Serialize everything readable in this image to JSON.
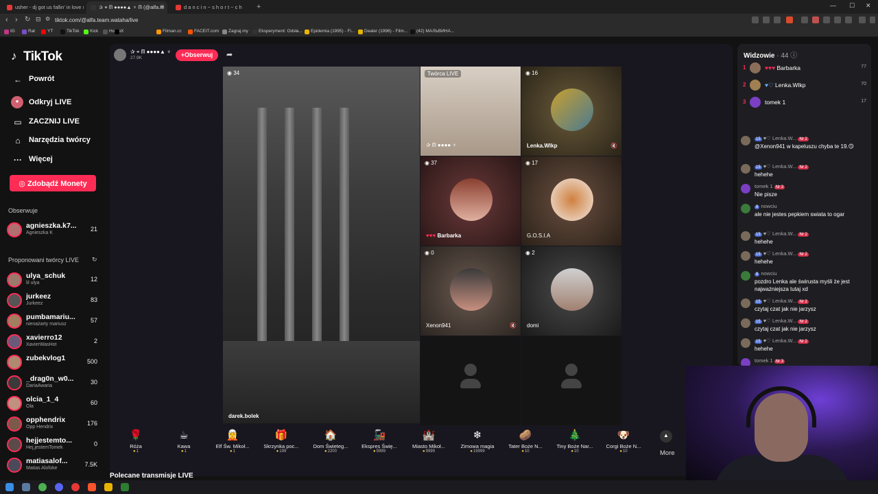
{
  "browser": {
    "tabs": [
      {
        "label": "usher - dj got us fallin' in love //"
      },
      {
        "label": "✰ ⌖ ᗰ ●●●●▲ ♆ ᗰ (@alfa.te"
      },
      {
        "label": "d a n c i n ~ s h o r t ~ c h"
      }
    ],
    "url": "tiktok.com/@alfa.team.wataha/live",
    "bookmarks": [
      "IG",
      "Rat",
      "YT",
      "TikTok",
      "Kick",
      "Home",
      "X",
      "Filman.cc",
      "FACEIT.com",
      "Zagraj.my",
      "Eksperyment: Odsła...",
      "Epidemia (1995) - Fi...",
      "Dealer (1996) - Film...",
      "(42) МАЛЬВИНА..."
    ]
  },
  "sidebar": {
    "logo": "TikTok",
    "nav": [
      {
        "icon": "arrow-left-icon",
        "label": "Powrót"
      },
      {
        "icon": "live-icon",
        "label": "Odkryj LIVE"
      },
      {
        "icon": "camera-icon",
        "label": "ZACZNIJ LIVE"
      },
      {
        "icon": "home-icon",
        "label": "Narzędzia twórcy"
      },
      {
        "icon": "more-icon",
        "label": "Więcej"
      }
    ],
    "coins_label": "Zdobądź Monety",
    "following_heading": "Obserwuje",
    "following": [
      {
        "name": "agnieszka.k7...",
        "sub": "Agnieszka K",
        "count": "21"
      }
    ],
    "suggested_heading": "Proponowani twórcy LIVE",
    "suggested": [
      {
        "name": "ulya_schuk",
        "sub": "lil ulya",
        "count": "12"
      },
      {
        "name": "jurkeez",
        "sub": "Jurkeez",
        "count": "83"
      },
      {
        "name": "pumbamariu...",
        "sub": "nienażarty mariusz",
        "count": "57"
      },
      {
        "name": "xavierro12",
        "sub": "XavierWasHot",
        "count": "2"
      },
      {
        "name": "zubekvlog1",
        "sub": "",
        "count": "500"
      },
      {
        "name": "_drag0n_w0...",
        "sub": "DariaAwaria",
        "count": "30"
      },
      {
        "name": "olcia_1_4",
        "sub": "Ola",
        "count": "60"
      },
      {
        "name": "opphendrix",
        "sub": "Opp Hendrix",
        "count": "176"
      },
      {
        "name": "hejjestemto...",
        "sub": "Hej,jestemTomek",
        "count": "0"
      },
      {
        "name": "matiasalof...",
        "sub": "Matias Alofoke",
        "count": "7.5K"
      }
    ]
  },
  "host": {
    "name": "✰ ⌖ ᗰ ●●●●▲ ♆",
    "followers": "27.9K",
    "follow_label": "+Obserwuj"
  },
  "grid": {
    "main": {
      "count": "34",
      "name": "darek.bolek"
    },
    "cells": [
      {
        "count": "",
        "name": "Twórca LIVE",
        "sub": "✰ ᗰ ●●●● ♆"
      },
      {
        "count": "16",
        "name": "Lenka.Wlkp"
      },
      {
        "count": "37",
        "name": "Barbarka"
      },
      {
        "count": "17",
        "name": "G.O.S.I.A"
      },
      {
        "count": "0",
        "name": "Xenon941"
      },
      {
        "count": "2",
        "name": "domi"
      }
    ]
  },
  "gifts": [
    {
      "name": "Róża",
      "price": "1",
      "icon": "🌹"
    },
    {
      "name": "Kawa",
      "price": "1",
      "icon": "☕"
    },
    {
      "name": "Elf Św. Mikoł...",
      "price": "1",
      "icon": "🧝"
    },
    {
      "name": "Skrzynka poc...",
      "price": "199",
      "icon": "🎁"
    },
    {
      "name": "Dom Świeteg...",
      "price": "2200",
      "icon": "🏠"
    },
    {
      "name": "Ekspres Świę...",
      "price": "5999",
      "icon": "🚂"
    },
    {
      "name": "Miasto Mikoł...",
      "price": "9999",
      "icon": "🏰"
    },
    {
      "name": "Zimowa magia",
      "price": "19999",
      "icon": "❄"
    },
    {
      "name": "Tater Boże N...",
      "price": "10",
      "icon": "🥔"
    },
    {
      "name": "Tiny Boże Nar...",
      "price": "10",
      "icon": "🎄"
    },
    {
      "name": "Corgi Boże N...",
      "price": "10",
      "icon": "🐶"
    }
  ],
  "more_label": "More",
  "recommended_label": "Polecane transmisje LIVE",
  "viewers": {
    "title": "Widzowie",
    "count": "· 44",
    "top": [
      {
        "rank": "1",
        "name": "Barbarka",
        "score": "77"
      },
      {
        "rank": "2",
        "name": "Lenka.Wlkp",
        "score": "70"
      },
      {
        "rank": "3",
        "name": "tomek 1",
        "score": "17"
      }
    ]
  },
  "chat": [
    {
      "user": "Lenka.W...",
      "badge": "15",
      "nr": "Nr 2",
      "text": "@Xenon941 w kapeluszu chyba te 19.🙃"
    },
    {
      "user": "Lenka.W...",
      "badge": "15",
      "nr": "Nr 2",
      "text": "hehehe"
    },
    {
      "user": "tomek 1",
      "badge": "",
      "nr": "Nr 3",
      "text": "Nie pisze"
    },
    {
      "user": "nowciu",
      "badge": "8",
      "nr": "",
      "text": "ale nie jestes pepkiem swiata to ogar"
    },
    {
      "user": "Lenka.W...",
      "badge": "15",
      "nr": "Nr 2",
      "text": "hehehe"
    },
    {
      "user": "Lenka.W...",
      "badge": "15",
      "nr": "Nr 2",
      "text": "hehehe"
    },
    {
      "user": "nowciu",
      "badge": "8",
      "nr": "",
      "text": "pozdro Lenka ale świrusta myśli że jest najważniejsza tutaj xd"
    },
    {
      "user": "Lenka.W...",
      "badge": "15",
      "nr": "Nr 2",
      "text": "czytaj czat jak nie jarzysz"
    },
    {
      "user": "Lenka.W...",
      "badge": "15",
      "nr": "Nr 2",
      "text": "czytaj czat jak nie jarzysz"
    },
    {
      "user": "Lenka.W...",
      "badge": "15",
      "nr": "Nr 2",
      "text": "hehehe"
    },
    {
      "user": "tomek 1",
      "badge": "",
      "nr": "Nr 3",
      "text": ""
    }
  ],
  "colors": {
    "accent": "#fe2c55",
    "background": "#121212"
  }
}
